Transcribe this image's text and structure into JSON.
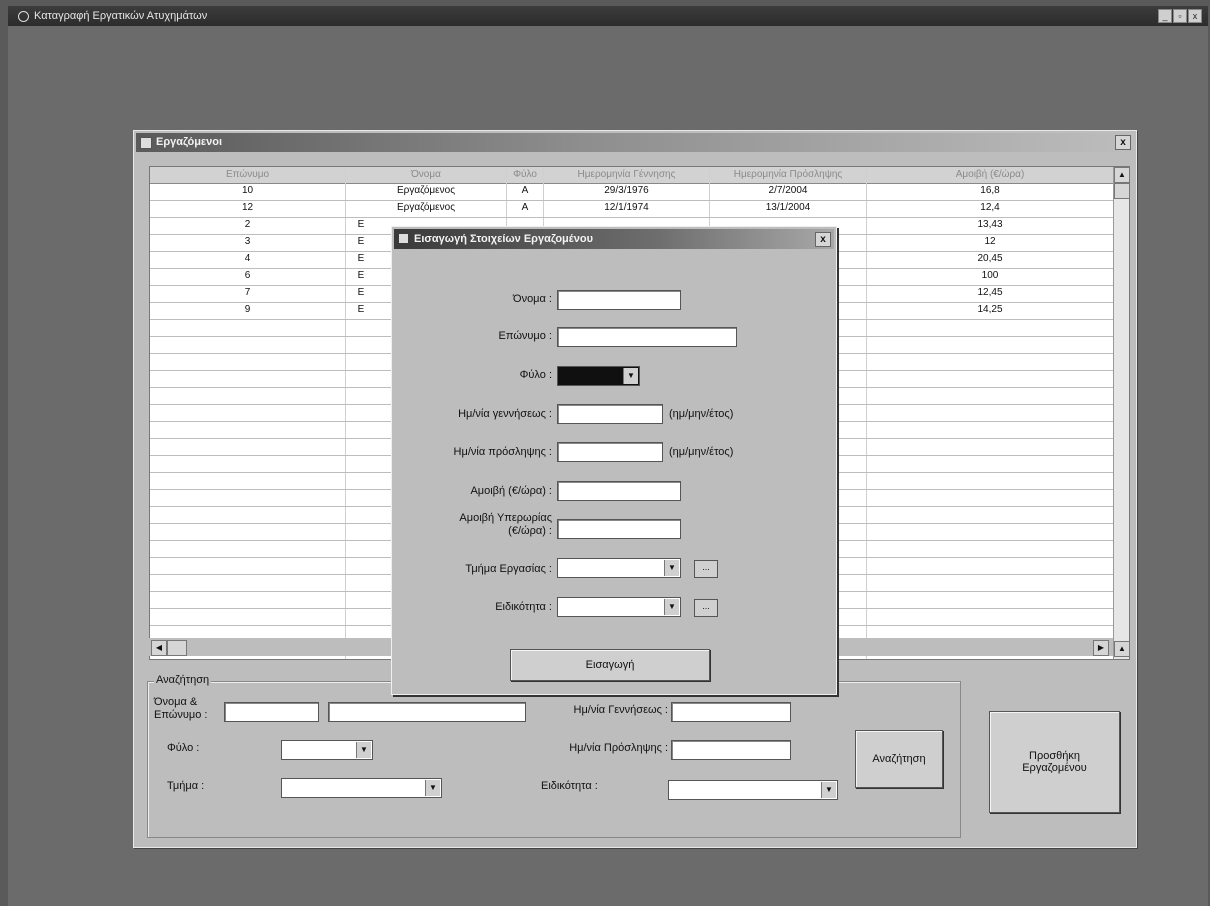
{
  "app": {
    "title": "Καταγραφή Εργατικών Ατυχημάτων",
    "controls": [
      "_",
      "▫",
      "x"
    ]
  },
  "employees_window": {
    "title": "Εργαζόμενοι",
    "close": "x",
    "grid": {
      "headers": [
        "Επώνυμο",
        "Όνομα",
        "Φύλο",
        "Ημερομηνία Γέννησης",
        "Ημερομηνία Πρόσληψης",
        "Αμοιβή (€/ώρα)"
      ],
      "rows": [
        [
          "10",
          "Εργαζόμενος",
          "Α",
          "29/3/1976",
          "2/7/2004",
          "16,8"
        ],
        [
          "12",
          "Εργαζόμενος",
          "Α",
          "12/1/1974",
          "13/1/2004",
          "12,4"
        ],
        [
          "2",
          "Ε",
          "",
          "",
          "",
          "13,43"
        ],
        [
          "3",
          "Ε",
          "",
          "",
          "",
          "12"
        ],
        [
          "4",
          "Ε",
          "",
          "",
          "",
          "20,45"
        ],
        [
          "6",
          "Ε",
          "",
          "",
          "",
          "100"
        ],
        [
          "7",
          "Ε",
          "",
          "",
          "",
          "12,45"
        ],
        [
          "9",
          "Ε",
          "",
          "",
          "",
          "14,25"
        ]
      ]
    },
    "search": {
      "legend": "Αναζήτηση",
      "name_label": "Όνομα & Επώνυμο :",
      "sex_label": "Φύλο :",
      "dept_label": "Τμήμα :",
      "birth_label": "Ημ/νία Γεννήσεως :",
      "hire_label": "Ημ/νία Πρόσληψης :",
      "spec_label": "Ειδικότητα :",
      "search_button": "Αναζήτηση"
    },
    "add_button": "Προσθήκη Εργαζομένου"
  },
  "dialog": {
    "title": "Εισαγωγή Στοιχείων Εργαζομένου",
    "close": "x",
    "first_name_label": "Όνομα :",
    "last_name_label": "Επώνυμο :",
    "sex_label": "Φύλο :",
    "birth_label": "Ημ/νία γεννήσεως :",
    "hire_label": "Ημ/νία πρόσληψης :",
    "date_hint": "(ημ/μην/έτος)",
    "pay_label": "Αμοιβή (€/ώρα) :",
    "overtime_label_1": "Αμοιβή Υπερωρίας",
    "overtime_label_2": "(€/ώρα) :",
    "dept_label": "Τμήμα Εργασίας :",
    "spec_label": "Ειδικότητα :",
    "more_button": "...",
    "insert_button": "Εισαγωγή"
  }
}
